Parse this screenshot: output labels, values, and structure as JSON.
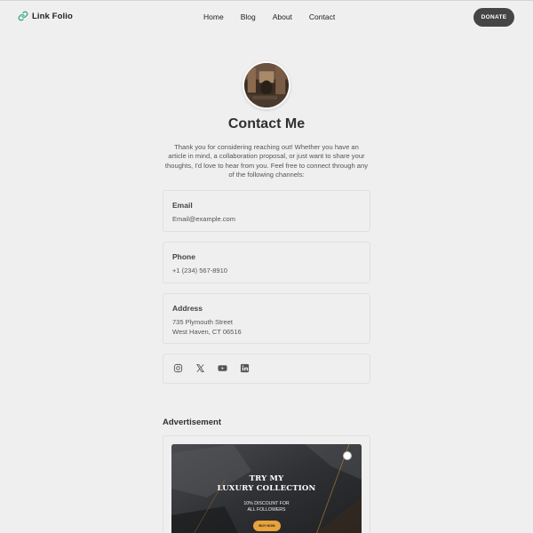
{
  "header": {
    "brand": "Link Folio",
    "nav": {
      "home": "Home",
      "blog": "Blog",
      "about": "About",
      "contact": "Contact"
    },
    "donate_label": "DONATE"
  },
  "profile": {
    "title": "Contact Me",
    "intro": "Thank you for considering reaching out! Whether you have an article in mind, a collaboration proposal, or just want to share your thoughts, I'd love to hear from you. Feel free to connect through any of the following channels:"
  },
  "contact": {
    "email": {
      "label": "Email",
      "value": "Email@example.com"
    },
    "phone": {
      "label": "Phone",
      "value": "+1 (234) 567-8910"
    },
    "address": {
      "label": "Address",
      "line1": "735 Plymouth Street",
      "line2": "West Haven, CT 06516"
    },
    "socials": [
      "instagram-icon",
      "x-icon",
      "youtube-icon",
      "linkedin-icon"
    ]
  },
  "advertisement": {
    "heading": "Advertisement",
    "title_line1": "TRY MY",
    "title_line2": "LUXURY COLLECTION",
    "sub_line1": "10% DISCOUNT FOR",
    "sub_line2": "ALL FOLLOWERS",
    "button_label": "BUY NOW"
  },
  "colors": {
    "background": "#efefef",
    "brand_icon": "#3aaa84",
    "donate_bg": "#454545",
    "ad_button": "#e8a33a"
  }
}
